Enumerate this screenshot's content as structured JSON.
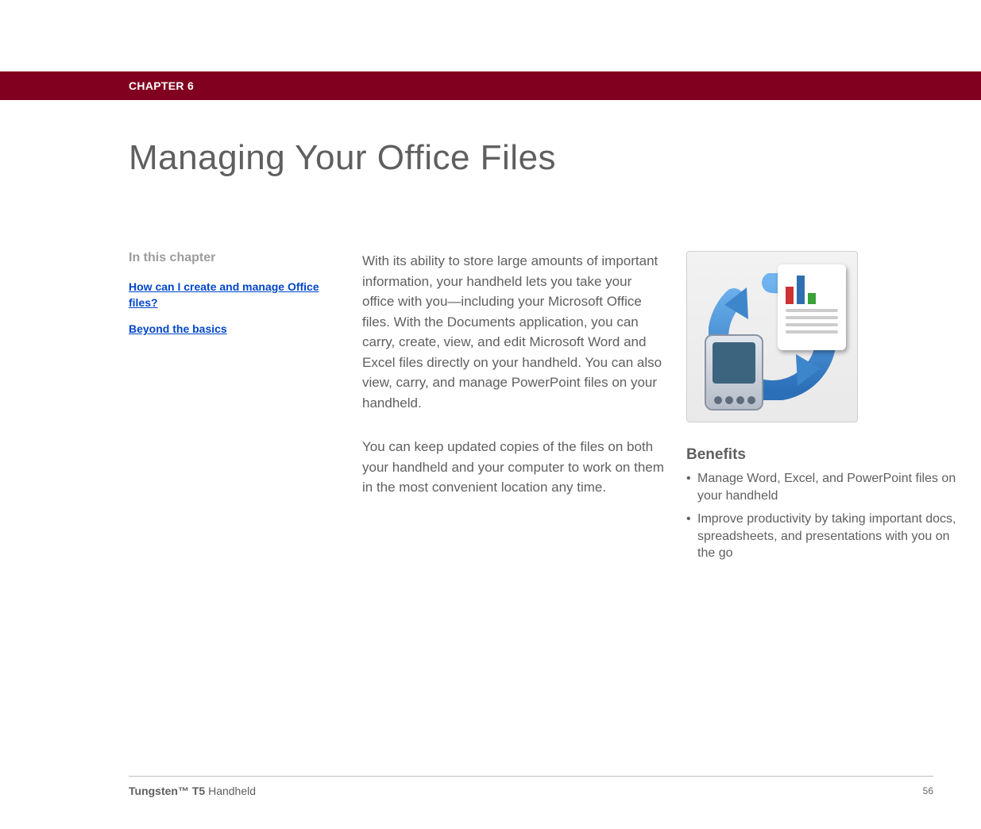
{
  "chapter_label": "CHAPTER 6",
  "page_title": "Managing Your Office Files",
  "sidebar": {
    "heading": "In this chapter",
    "links": [
      "How can I create and manage Office files?",
      "Beyond the basics"
    ]
  },
  "main": {
    "para1": "With its ability to store large amounts of important information, your handheld lets you take your office with you—including your Microsoft Office files. With the Documents application, you can carry, create, view, and edit Microsoft Word and Excel files directly on your handheld. You can also view, carry, and manage PowerPoint files on your handheld.",
    "para2": "You can keep updated copies of the files on both your handheld and your computer to work on them in the most convenient location any time."
  },
  "benefits": {
    "heading": "Benefits",
    "items": [
      "Manage Word, Excel, and PowerPoint files on your handheld",
      "Improve productivity by taking important docs, spreadsheets, and presentations with you on the go"
    ]
  },
  "footer": {
    "product_bold": "Tungsten™ T5",
    "product_rest": " Handheld",
    "page_number": "56"
  }
}
